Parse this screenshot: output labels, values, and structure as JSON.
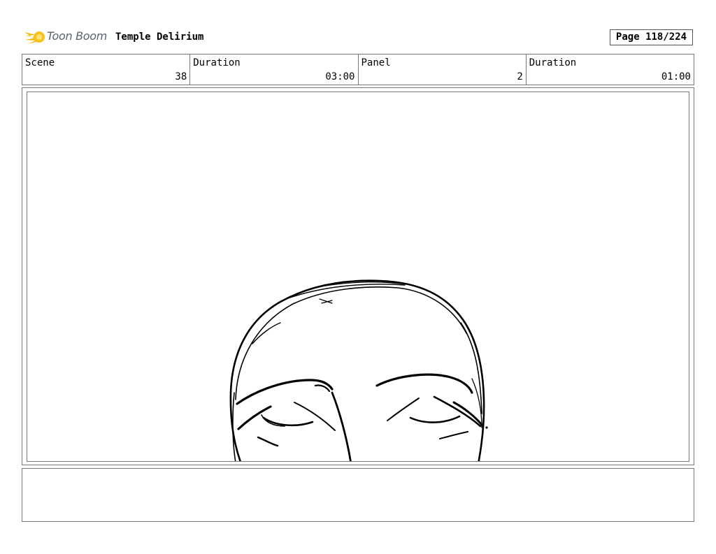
{
  "header": {
    "logo_text": "Toon Boom",
    "project_title": "Temple Delirium",
    "page_label": "Page 118/224"
  },
  "info": {
    "scene_label": "Scene",
    "scene_value": "38",
    "scene_duration_label": "Duration",
    "scene_duration_value": "03:00",
    "panel_label": "Panel",
    "panel_value": "2",
    "panel_duration_label": "Duration",
    "panel_duration_value": "01:00"
  },
  "icons": {
    "logo": "toon-boom-logo-icon",
    "sketch": "face-sketch-drawing"
  },
  "colors": {
    "logo_accent": "#f5b800",
    "logo_text": "#5a6470",
    "border": "#777777"
  },
  "notes": {
    "text": ""
  }
}
